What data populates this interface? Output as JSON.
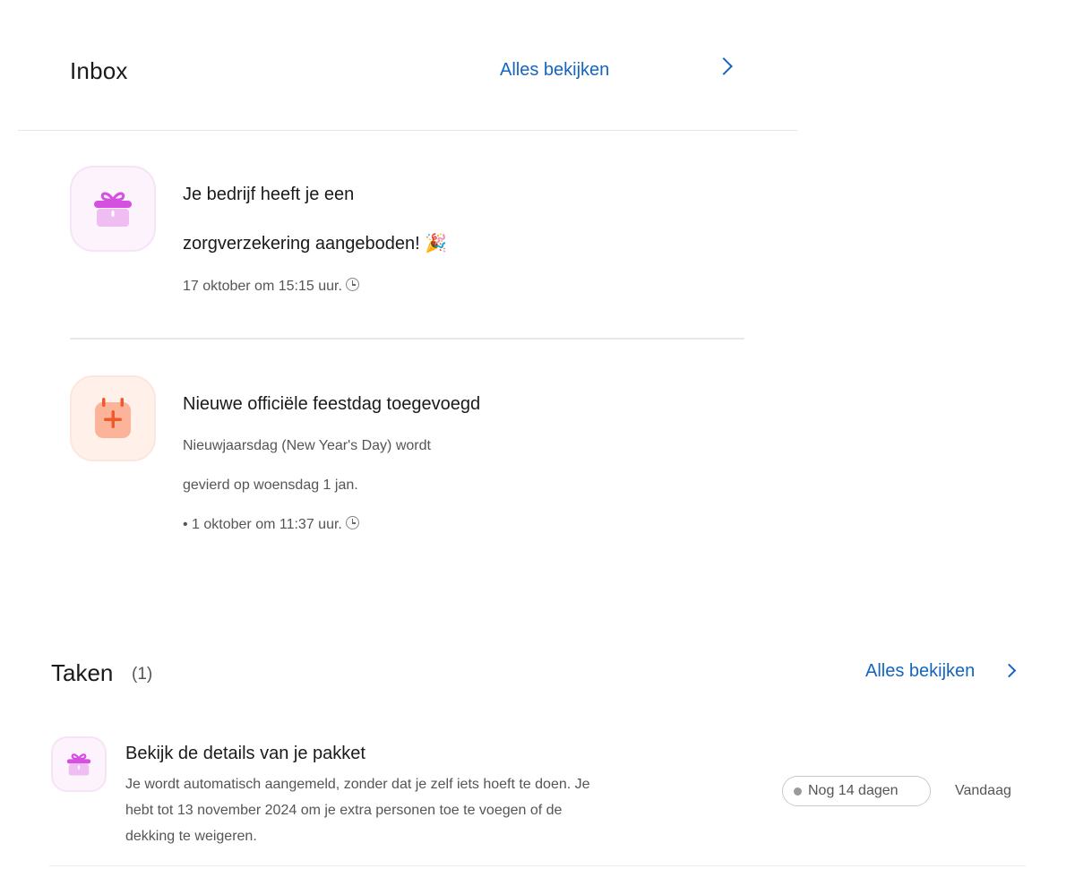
{
  "inbox": {
    "title": "Inbox",
    "view_all": "Alles bekijken",
    "messages": [
      {
        "icon": "gift-icon",
        "title_line1": "Je bedrijf heeft je een",
        "title_line2": "zorgverzekering aangeboden! 🎉",
        "time": "17 oktober om 15:15 uur."
      },
      {
        "icon": "calendar-plus-icon",
        "title": "Nieuwe officiële feestdag toegevoegd",
        "body_line1": "Nieuwjaarsdag (New Year's Day) wordt",
        "body_line2": "gevierd op woensdag 1 jan.",
        "time": "• 1 oktober om 11:37 uur."
      }
    ]
  },
  "tasks": {
    "title": "Taken",
    "count": "(1)",
    "view_all": "Alles bekijken",
    "items": [
      {
        "icon": "gift-icon",
        "title": "Bekijk de details van je pakket",
        "desc_line1": "Je wordt automatisch aangemeld, zonder dat je zelf iets hoeft te doen. Je",
        "desc_line2": "hebt tot 13 november 2024 om je extra personen toe te voegen of de",
        "desc_line3": "dekking te weigeren.",
        "badge": "Nog 14 dagen",
        "due": "Vandaag"
      }
    ]
  },
  "colors": {
    "link": "#1565c0",
    "gift_purple": "#d54fe0",
    "calendar_orange": "#ef5a2a"
  }
}
